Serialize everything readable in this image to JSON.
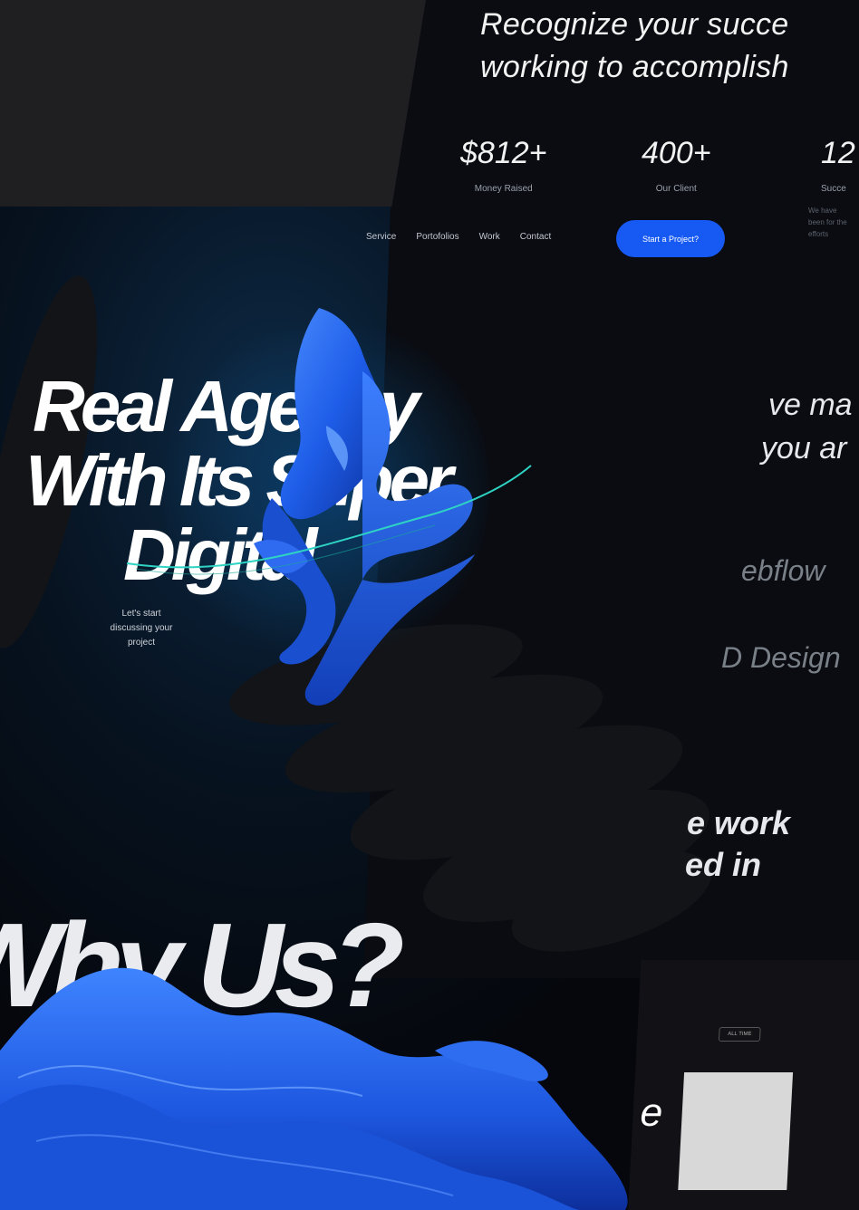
{
  "header": {
    "recognize_line1": "Recognize your succe",
    "recognize_line2": "working to accomplish"
  },
  "stats": [
    {
      "value": "$812+",
      "label": "Money Raised"
    },
    {
      "value": "400+",
      "label": "Our Client"
    },
    {
      "value": "12",
      "label": "Succe"
    }
  ],
  "stat_note": "We have\nbeen for the\nefforts",
  "nav": {
    "items": [
      "Service",
      "Portofolios",
      "Work",
      "Contact"
    ],
    "cta": "Start a Project?"
  },
  "hero": {
    "line1": "Real Agency",
    "line2": "With Its Super",
    "line3": "Digital",
    "sub": "Let's start discussing your project"
  },
  "right": {
    "heading1": "ve ma",
    "heading2": "you ar",
    "item1": "ebflow",
    "item2": "D Design",
    "work1": "e work",
    "work2": "ed in"
  },
  "why": "Why Us?",
  "thumb": {
    "tag": "ALL TIME",
    "letter": "e"
  },
  "colors": {
    "accent": "#1659f3",
    "background": "#05070c",
    "panel": "#1f1f21",
    "sculpture": "#1f5fe6"
  }
}
